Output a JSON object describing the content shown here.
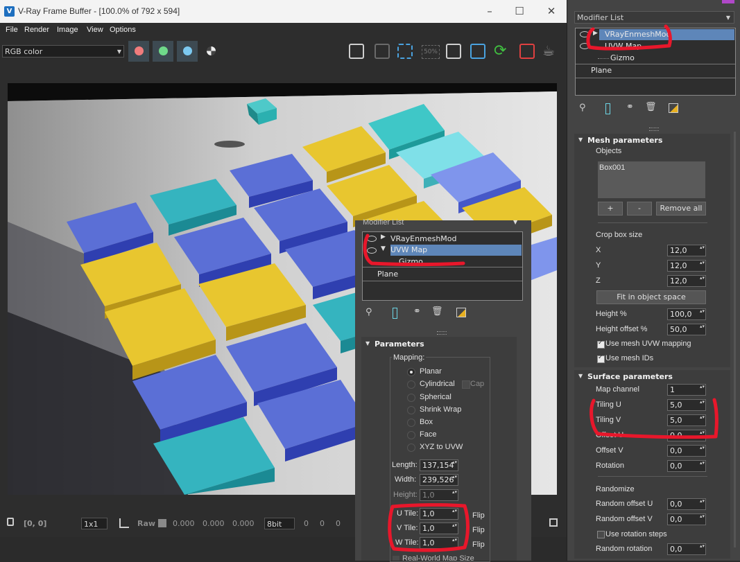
{
  "vfb": {
    "title": "V-Ray Frame Buffer - [100.0% of 792 x 594]",
    "logo_letter": "V",
    "menu": [
      "File",
      "Render",
      "Image",
      "View",
      "Options"
    ],
    "channel": "RGB color",
    "zoom_chip": "50%",
    "status": {
      "coords": "[0, 0]",
      "ratio": "1x1",
      "raw_label": "Raw",
      "v1": "0.000",
      "v2": "0.000",
      "v3": "0.000",
      "bitdepth": "8bit",
      "p1": "0",
      "p2": "0",
      "p3": "0"
    },
    "colors": {
      "red": "#f07c7c",
      "green": "#6fd98a",
      "blue": "#7cc9f0"
    }
  },
  "right": {
    "modifier_list": "Modifier List",
    "stack": [
      {
        "label": "VRayEnmeshMod",
        "selected": true
      },
      {
        "label": "UVW Map",
        "selected": false
      },
      {
        "label": "Gizmo",
        "selected": false
      },
      {
        "label": "Plane",
        "selected": false
      }
    ],
    "mesh": {
      "title": "Mesh parameters",
      "objects_label": "Objects",
      "objects": [
        "Box001"
      ],
      "add": "+",
      "remove": "-",
      "remove_all": "Remove all",
      "crop_label": "Crop box size",
      "x_label": "X",
      "x": "12,0",
      "y_label": "Y",
      "y": "12,0",
      "z_label": "Z",
      "z": "12,0",
      "fit": "Fit in object space",
      "height_label": "Height %",
      "height": "100,0",
      "height_offset_label": "Height offset %",
      "height_offset": "50,0",
      "use_uvw": "Use mesh UVW mapping",
      "use_ids": "Use mesh IDs"
    },
    "surface": {
      "title": "Surface parameters",
      "map_channel_label": "Map channel",
      "map_channel": "1",
      "tiling_u_label": "Tiling U",
      "tiling_u": "5,0",
      "tiling_v_label": "Tiling V",
      "tiling_v": "5,0",
      "offset_u_label": "Offset U",
      "offset_u": "0,0",
      "offset_v_label": "Offset V",
      "offset_v": "0,0",
      "rotation_label": "Rotation",
      "rotation": "0,0",
      "randomize_label": "Randomize",
      "rand_offset_u_label": "Random offset U",
      "rand_offset_u": "0,0",
      "rand_offset_v_label": "Random offset V",
      "rand_offset_v": "0,0",
      "use_rot_steps": "Use rotation steps",
      "rand_rot_label": "Random rotation",
      "rand_rot": "0,0"
    }
  },
  "overlay": {
    "modifier_list": "Modifier List",
    "stack": [
      {
        "label": "VRayEnmeshMod",
        "selected": false
      },
      {
        "label": "UVW Map",
        "selected": true
      },
      {
        "label": "Gizmo",
        "selected": false
      },
      {
        "label": "Plane",
        "selected": false
      }
    ],
    "params_title": "Parameters",
    "mapping_label": "Mapping:",
    "mapping_options": [
      "Planar",
      "Cylindrical",
      "Spherical",
      "Shrink Wrap",
      "Box",
      "Face",
      "XYZ to UVW"
    ],
    "cap_label": "Cap",
    "length_label": "Length:",
    "length": "137,154",
    "width_label": "Width:",
    "width": "239,526",
    "height_label": "Height:",
    "height": "1,0",
    "u_tile_label": "U Tile:",
    "u_tile": "1,0",
    "v_tile_label": "V Tile:",
    "v_tile": "1,0",
    "w_tile_label": "W Tile:",
    "w_tile": "1,0",
    "flip_label": "Flip",
    "bottom_label": "Real-World Map Size"
  }
}
